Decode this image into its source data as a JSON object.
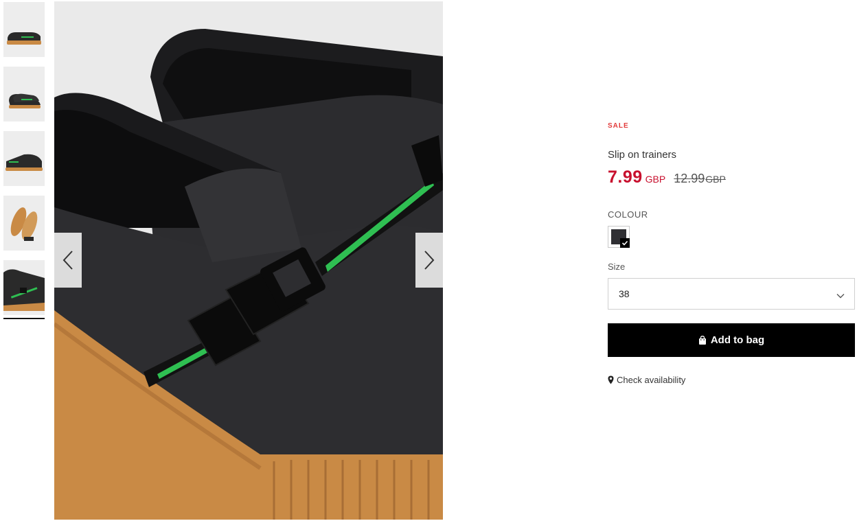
{
  "gallery": {
    "thumbnails": [
      {
        "label": "thumbnail-1"
      },
      {
        "label": "thumbnail-2"
      },
      {
        "label": "thumbnail-3"
      },
      {
        "label": "thumbnail-4"
      },
      {
        "label": "thumbnail-5"
      }
    ],
    "active_index": 5,
    "prev_icon": "chevron-left-icon",
    "next_icon": "chevron-right-icon"
  },
  "product": {
    "badge": "SALE",
    "title": "Slip on trainers",
    "price_now": "7.99",
    "price_now_currency": "GBP",
    "price_old": "12.99",
    "price_old_currency": "GBP",
    "colour_label": "COLOUR",
    "colour_selected": "#2f2f33",
    "size_label": "Size",
    "size_value": "38",
    "add_to_bag_label": "Add to bag",
    "check_availability_label": "Check availability"
  },
  "colors": {
    "sale_red": "#e23b3b",
    "price_red": "#c8102e",
    "button_bg": "#000000",
    "stripe_green": "#2fbf52",
    "sole_gum": "#c98a45"
  }
}
